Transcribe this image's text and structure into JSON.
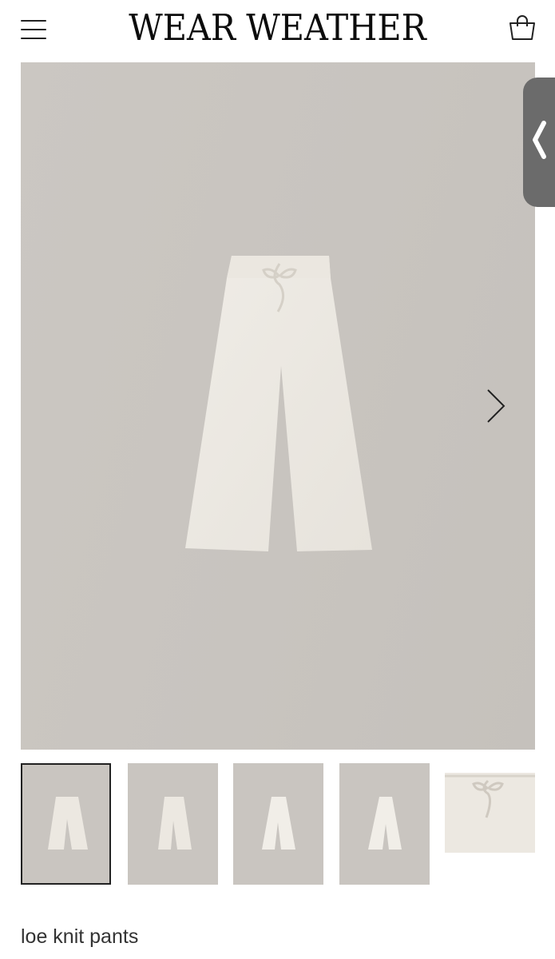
{
  "header": {
    "brand": "WEAR WEATHER",
    "menu_icon": "hamburger-menu-icon",
    "cart_icon": "shopping-bag-icon"
  },
  "gallery": {
    "background": "#c9c5c0",
    "garment_color": "#ece8e1",
    "next_icon": "chevron-right-icon",
    "thumbnails": [
      {
        "view": "front",
        "active": true
      },
      {
        "view": "front-2",
        "active": false
      },
      {
        "view": "side",
        "active": false
      },
      {
        "view": "back",
        "active": false
      },
      {
        "view": "waistband-closeup",
        "active": false
      }
    ]
  },
  "side_tab": {
    "icon": "chevron-left-icon",
    "color": "#6b6b6b"
  },
  "product": {
    "name": "loe knit pants"
  }
}
